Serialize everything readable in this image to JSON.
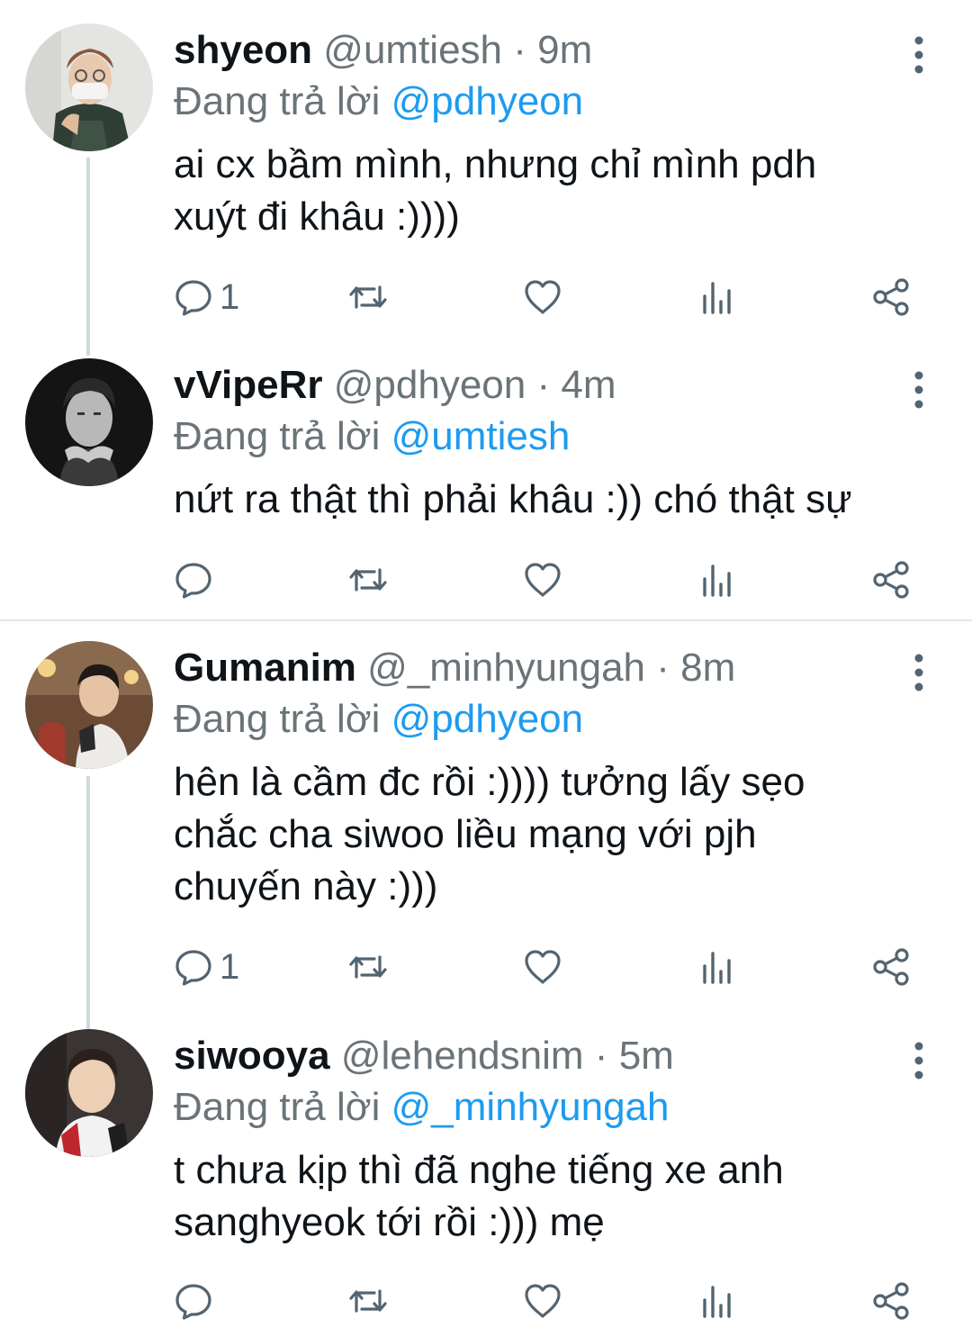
{
  "reply_prefix": "Đang trả lời",
  "colors": {
    "mention": "#1d9bf0",
    "meta": "#6a7378",
    "text": "#0f1419",
    "thread_line": "#cfd9de"
  },
  "tweets": [
    {
      "name": "shyeon",
      "handle": "@umtiesh",
      "time": "9m",
      "reply_to": "@pdhyeon",
      "text_lines": [
        "ai cx bầm mình, nhưng chỉ mình pdh",
        "xuýt đi khâu :))))"
      ],
      "reply_count": "1",
      "avatar": "avatar-shyeon"
    },
    {
      "name": "vVipeRr",
      "handle": "@pdhyeon",
      "time": "4m",
      "reply_to": "@umtiesh",
      "text_lines": [
        "nứt ra thật thì phải khâu :)) chó thật sự"
      ],
      "reply_count": "",
      "avatar": "avatar-vviperr"
    },
    {
      "name": "Gumanim",
      "handle": "@_minhyungah",
      "time": "8m",
      "reply_to": "@pdhyeon",
      "text_lines": [
        "hên là cầm đc rồi :)))) tưởng lấy sẹo",
        "chắc cha siwoo liều mạng với pjh",
        "chuyến này :)))"
      ],
      "reply_count": "1",
      "avatar": "avatar-gumanim"
    },
    {
      "name": "siwooya",
      "handle": "@lehendsnim",
      "time": "5m",
      "reply_to": "@_minhyungah",
      "text_lines": [
        "t chưa kịp thì đã nghe tiếng xe anh",
        "sanghyeok tới rồi :))) mẹ"
      ],
      "reply_count": "",
      "avatar": "avatar-siwooya"
    }
  ]
}
